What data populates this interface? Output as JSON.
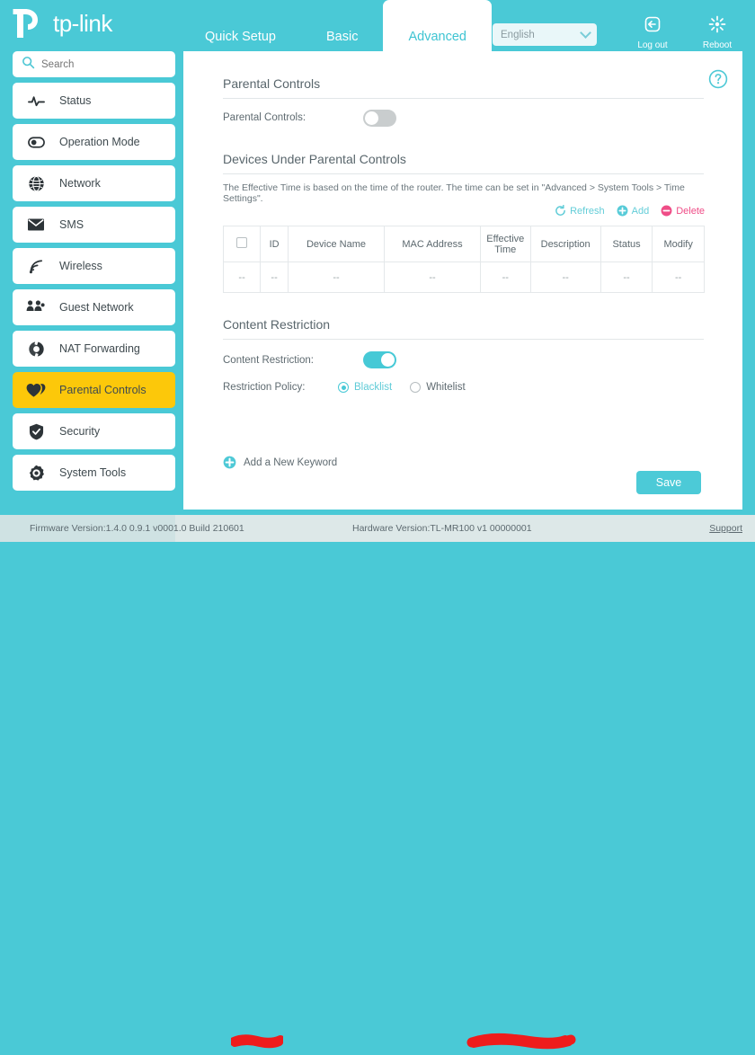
{
  "brand": {
    "name": "tp-link"
  },
  "header": {
    "tabs": [
      {
        "label": "Quick Setup",
        "active": false
      },
      {
        "label": "Basic",
        "active": false
      },
      {
        "label": "Advanced",
        "active": true
      }
    ],
    "language": {
      "value": "English",
      "icon": "chevron-down-icon"
    },
    "actions": [
      {
        "label": "Log out",
        "icon": "logout-icon"
      },
      {
        "label": "Reboot",
        "icon": "reboot-icon"
      }
    ]
  },
  "sidebar": {
    "search": {
      "placeholder": "Search",
      "value": "",
      "icon": "search-icon"
    },
    "items": [
      {
        "label": "Status",
        "icon": "pulse-icon",
        "active": false
      },
      {
        "label": "Operation Mode",
        "icon": "mode-dot-icon",
        "active": false
      },
      {
        "label": "Network",
        "icon": "globe-icon",
        "active": false
      },
      {
        "label": "SMS",
        "icon": "envelope-icon",
        "active": false
      },
      {
        "label": "Wireless",
        "icon": "wifi-icon",
        "active": false
      },
      {
        "label": "Guest Network",
        "icon": "people-icon",
        "active": false
      },
      {
        "label": "NAT Forwarding",
        "icon": "refresh-circle-icon",
        "active": false
      },
      {
        "label": "Parental Controls",
        "icon": "hearts-icon",
        "active": true
      },
      {
        "label": "Security",
        "icon": "shield-icon",
        "active": false
      },
      {
        "label": "System Tools",
        "icon": "gear-icon",
        "active": false
      }
    ]
  },
  "main": {
    "help_icon": "help-circle-icon",
    "parental": {
      "section_title": "Parental Controls",
      "toggle_label": "Parental Controls:",
      "toggle_state": "off"
    },
    "devices": {
      "section_title": "Devices Under Parental Controls",
      "note": "The Effective Time is based on the time of the router. The time can be set in \"Advanced > System Tools > Time Settings\".",
      "actions": [
        {
          "label": "Refresh",
          "icon": "refresh-icon",
          "color": "#63cdd8"
        },
        {
          "label": "Add",
          "icon": "plus-circle-icon",
          "color": "#63cdd8"
        },
        {
          "label": "Delete",
          "icon": "minus-circle-icon",
          "color": "#ef4d87"
        }
      ],
      "columns": [
        "",
        "ID",
        "Device Name",
        "MAC Address",
        "Effective Time",
        "Description",
        "Status",
        "Modify"
      ],
      "rows": [
        [
          "--",
          "--",
          "--",
          "--",
          "--",
          "--",
          "--",
          "--"
        ]
      ]
    },
    "content_restriction": {
      "section_title": "Content Restriction",
      "toggle_label": "Content Restriction:",
      "toggle_state": "on",
      "policy_label": "Restriction Policy:",
      "policy_options": [
        {
          "label": "Blacklist",
          "selected": true
        },
        {
          "label": "Whitelist",
          "selected": false
        }
      ],
      "add_keyword_label": "Add a New Keyword",
      "add_keyword_icon": "plus-circle-icon"
    },
    "save_label": "Save"
  },
  "footer": {
    "firmware": "Firmware Version:1.4.0 0.9.1 v0001.0 Build 210601",
    "hardware": "Hardware Version:TL-MR100 v1 00000001",
    "support": "Support"
  },
  "colors": {
    "teal": "#4ac9d6",
    "yellow": "#fcc80a",
    "pink": "#ef4d87",
    "redaction": "#ee1c1c"
  }
}
